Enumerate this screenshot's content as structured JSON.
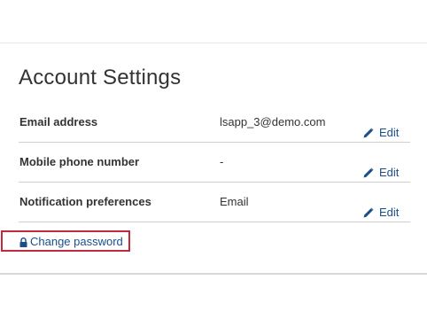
{
  "page": {
    "title": "Account Settings"
  },
  "settings": {
    "rows": [
      {
        "label": "Email address",
        "value": "lsapp_3@demo.com",
        "edit_label": "Edit"
      },
      {
        "label": "Mobile phone number",
        "value": "-",
        "edit_label": "Edit"
      },
      {
        "label": "Notification preferences",
        "value": "Email",
        "edit_label": "Edit"
      }
    ]
  },
  "actions": {
    "change_password_label": "Change password"
  },
  "colors": {
    "link": "#1a4f8a",
    "highlight_border": "#c02a3c"
  },
  "icons": {
    "edit": "pencil-icon",
    "change_password": "lock-icon"
  }
}
